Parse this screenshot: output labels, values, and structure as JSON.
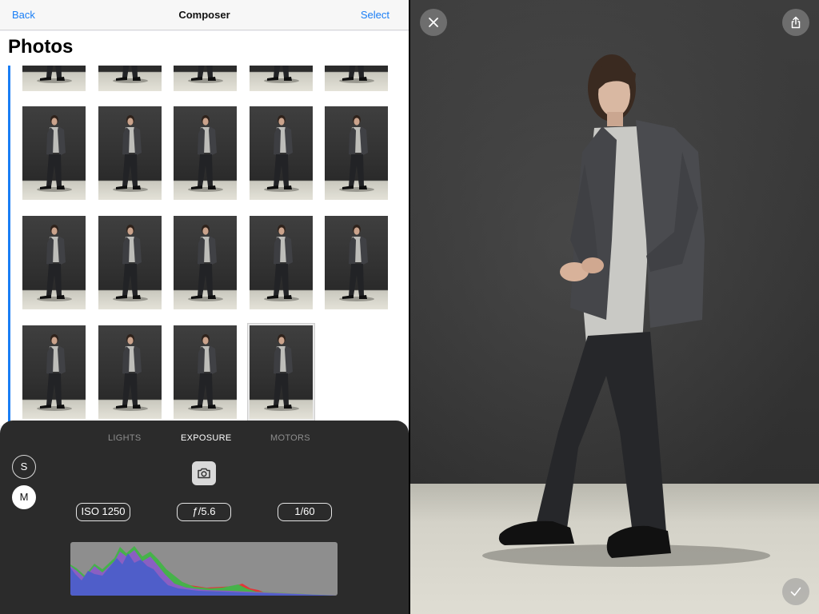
{
  "nav": {
    "back_label": "Back",
    "title": "Composer",
    "select_label": "Select"
  },
  "photos": {
    "title": "Photos"
  },
  "panel": {
    "tabs": [
      {
        "label": "LIGHTS",
        "active": false
      },
      {
        "label": "EXPOSURE",
        "active": true
      },
      {
        "label": "MOTORS",
        "active": false
      }
    ],
    "modes": [
      {
        "label": "S",
        "selected": false
      },
      {
        "label": "M",
        "selected": true
      }
    ],
    "camera_icon": "camera-icon",
    "iso": "ISO 1250",
    "aperture": "ƒ/5.6",
    "shutter": "1/60"
  },
  "viewer": {
    "close_icon": "close-icon",
    "share_icon": "share-icon",
    "done_icon": "checkmark-icon"
  },
  "colors": {
    "accent": "#1a7ef5",
    "panel_bg": "#2b2b2b",
    "histogram_bg": "#8e8e8e",
    "hist_blue": "#4f5ec9",
    "hist_purple": "#8a5fc2",
    "hist_green": "#46b24a",
    "hist_red": "#e2363a"
  }
}
